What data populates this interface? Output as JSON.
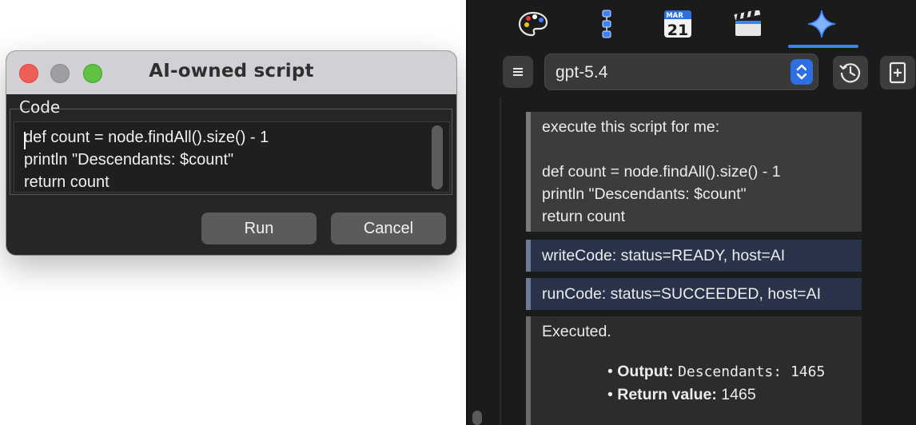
{
  "dialog": {
    "title": "AI-owned script",
    "code_label": "Code",
    "code_lines": [
      "def count = node.findAll().size() - 1",
      "println \"Descendants: $count\"",
      "return count"
    ],
    "run_label": "Run",
    "cancel_label": "Cancel"
  },
  "panel": {
    "tool_icons": [
      "palette-icon",
      "node-list-icon",
      "calendar-icon",
      "clapperboard-icon",
      "sparkle-icon"
    ],
    "calendar": {
      "month": "MAR",
      "day": "21"
    },
    "active_tab_color": "#3b82f6",
    "model": "gpt-5.4",
    "messages": {
      "user_lines": [
        "execute this script for me:",
        "",
        "def count = node.findAll().size() - 1",
        "println \"Descendants: $count\"",
        "return count"
      ],
      "write_status": "writeCode: status=READY, host=AI",
      "run_status": "runCode: status=SUCCEEDED, host=AI",
      "result": {
        "heading": "Executed.",
        "output_label": "Output:",
        "output_value": "Descendants: 1465",
        "return_label": "Return value:",
        "return_value": "1465"
      }
    }
  }
}
